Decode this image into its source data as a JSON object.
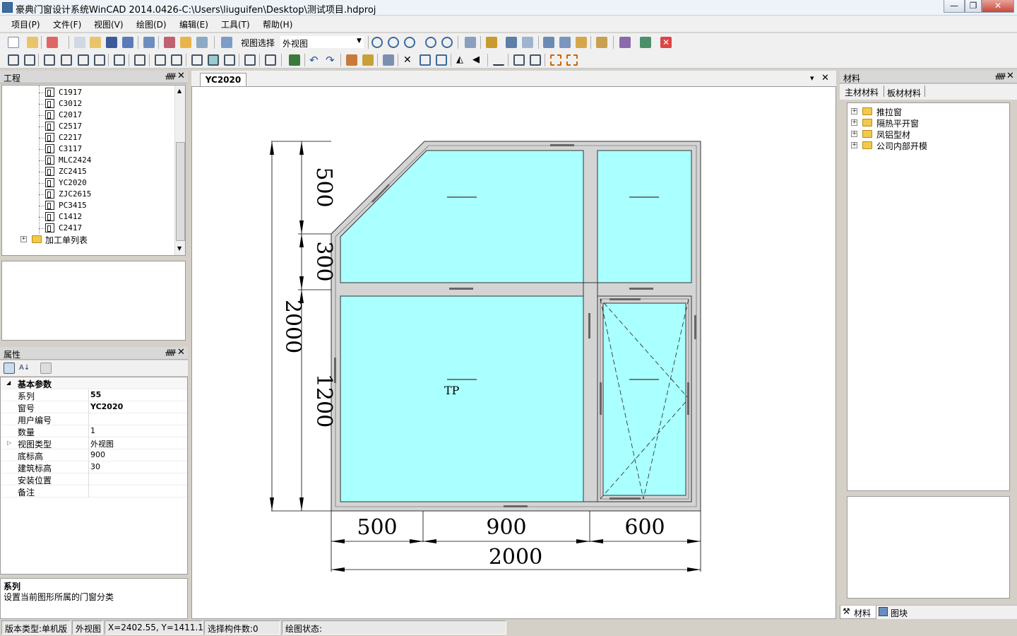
{
  "title_bar": {
    "title": "豪典门窗设计系统WinCAD 2014.0426-C:\\Users\\liuguifen\\Desktop\\测试项目.hdproj",
    "minimize_label": "—",
    "restore_label": "❐",
    "close_label": "✕"
  },
  "menu": [
    "项目(P)",
    "文件(F)",
    "视图(V)",
    "绘图(D)",
    "编辑(E)",
    "工具(T)",
    "帮助(H)"
  ],
  "toolbar": {
    "view_select_label": "视图选择",
    "view_select_value": "外视图"
  },
  "project_panel": {
    "title": "工程",
    "pin": "ᚏ",
    "close": "✕",
    "items": [
      "C1917",
      "C3012",
      "C2017",
      "C2517",
      "C2217",
      "C3117",
      "MLC2424",
      "ZC2415",
      "YC2020",
      "ZJC2615",
      "PC3415",
      "C1412",
      "C2417"
    ],
    "folder_label": "加工单列表",
    "expander": "+"
  },
  "properties_panel": {
    "title": "属性",
    "group_label": "基本参数",
    "rows": [
      {
        "key": "系列",
        "value": "55"
      },
      {
        "key": "窗号",
        "value": "YC2020"
      },
      {
        "key": "用户编号",
        "value": ""
      },
      {
        "key": "数量",
        "value": "1"
      },
      {
        "key": "视图类型",
        "value": "外视图"
      },
      {
        "key": "底标高",
        "value": "900"
      },
      {
        "key": "建筑标高",
        "value": "30"
      },
      {
        "key": "安装位置",
        "value": ""
      },
      {
        "key": "备注",
        "value": ""
      }
    ],
    "desc_title": "系列",
    "desc_text": "设置当前图形所属的门窗分类"
  },
  "document": {
    "tab_label": "YC2020",
    "dropdown_arrow": "▾",
    "close": "✕",
    "dimensions": {
      "left_top": "500",
      "left_mid": "300",
      "left_bottom": "1200",
      "left_total": "2000",
      "bottom_1": "500",
      "bottom_2": "900",
      "bottom_3": "600",
      "bottom_total": "2000"
    },
    "pane_label": "TP"
  },
  "materials_panel": {
    "title": "材料",
    "tabs": [
      "主材材料",
      "板材材料"
    ],
    "tree": [
      "推拉窗",
      "隔热平开窗",
      "凤铝型材",
      "公司内部开模"
    ],
    "bottom_tabs": [
      "材料",
      "图块"
    ]
  },
  "status_bar": {
    "version": "版本类型:单机版",
    "view": "外视图",
    "coords": "X=2402.55, Y=1411.13",
    "selected": "选择构件数:0",
    "draw_state": "绘图状态:"
  },
  "colors": {
    "glass": "#aaffff",
    "frame": "#d4d4d4",
    "panel_bg": "#d4d0c8",
    "title_bg": "#eef3f9"
  }
}
